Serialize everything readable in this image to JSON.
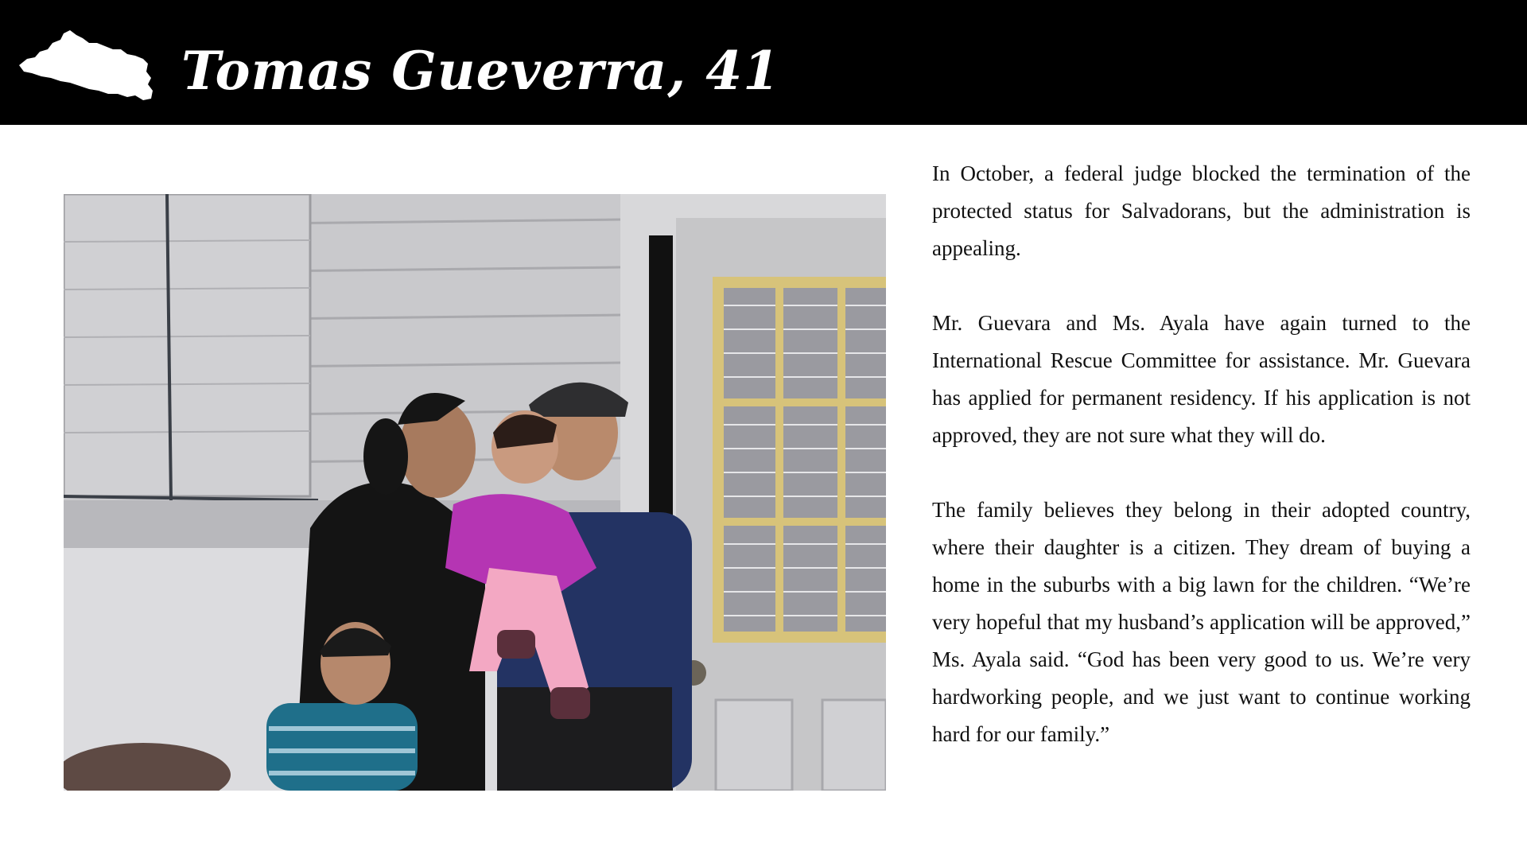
{
  "header": {
    "title": "Tomas Gueverra, 41",
    "icon": "el-salvador-map-icon",
    "background": "#000000",
    "text_color": "#ffffff"
  },
  "photo": {
    "icon": "family-portrait-photo"
  },
  "article": {
    "paragraphs": [
      "In October, a federal judge blocked the termination of the protected status for Salvadorans, but the administration is appealing.",
      "Mr. Guevara and Ms. Ayala have again turned to the International Rescue Committee for assistance. Mr. Guevara has applied for permanent residency. If his application is not approved, they are not sure what they will do.",
      "The family believes they belong in their adopted country, where their daughter is a citizen. They dream of buying a home in the suburbs with a big lawn for the children. “We’re very hopeful that my husband’s application will be approved,” Ms. Ayala said. “God has been very good to us. We’re very hardworking people, and we just want to continue working hard for our family.”"
    ]
  }
}
